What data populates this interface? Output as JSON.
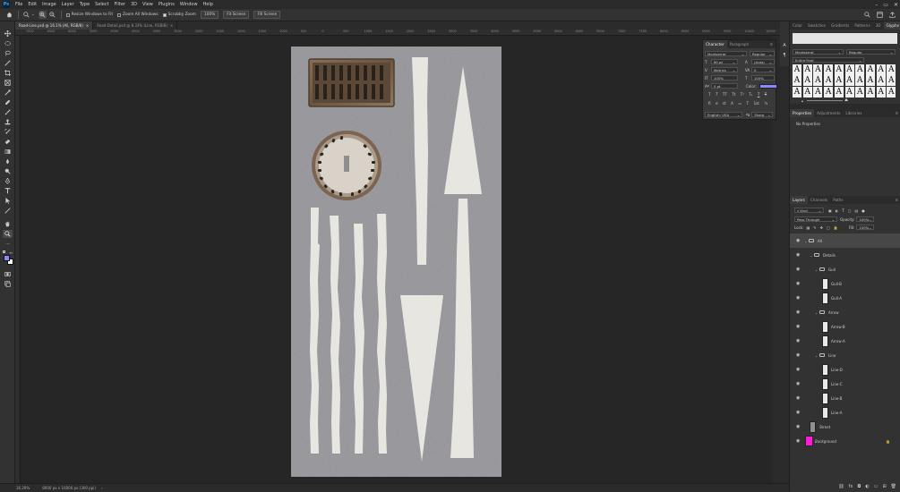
{
  "app": {
    "logo": "Ps"
  },
  "menu": [
    "File",
    "Edit",
    "Image",
    "Layer",
    "Type",
    "Select",
    "Filter",
    "3D",
    "View",
    "Plugins",
    "Window",
    "Help"
  ],
  "options": {
    "resize_windows": "Resize Windows to Fit",
    "zoom_all": "Zoom All Windows",
    "scrubby_zoom": "Scrubby Zoom",
    "zoom_value": "100%",
    "fit_screen": "Fit Screen",
    "fill_screen": "Fill Screen"
  },
  "tabs": [
    {
      "label": "Road-Line.psd @ 16.1% (All, RGB/8)",
      "active": true
    },
    {
      "label": "Road-Detail.psd @ 8.33% (Line, RGB/8)",
      "active": false
    }
  ],
  "ruler_numbers": [
    "7000",
    "6500",
    "6000",
    "5500",
    "5000",
    "4500",
    "4000",
    "3500",
    "3000",
    "2500",
    "2000",
    "1500",
    "1000",
    "500",
    "0",
    "500",
    "1000",
    "1500",
    "2000",
    "2500",
    "3000",
    "3500",
    "4000",
    "4500",
    "5000",
    "5500",
    "6000",
    "6500",
    "7000",
    "7500",
    "8000",
    "8500",
    "9000",
    "9500",
    "10000",
    "10500"
  ],
  "status": {
    "zoom": "16.29%",
    "doc": "8000 px x 16000 px (300 ppi)"
  },
  "character_panel": {
    "tabs": [
      "Character",
      "Paragraph"
    ],
    "font_family": "Montserrat",
    "font_style": "Regular",
    "size": "60 pt",
    "leading": "(Auto)",
    "kerning": "Metrics",
    "tracking": "0",
    "vscale": "100%",
    "hscale": "100%",
    "baseline": "0 pt",
    "color_label": "Color:",
    "color": "#8a8aff",
    "language": "English: USA",
    "antialias": "Sharp"
  },
  "glyphs_panel": {
    "tabs": [
      "Color",
      "Swatches",
      "Gradients",
      "Patterns",
      "3D",
      "Glyphs"
    ],
    "font": "Montserrat",
    "style": "Regular",
    "subset": "Entire Font",
    "glyph": "A"
  },
  "properties_panel": {
    "tabs": [
      "Properties",
      "Adjustments",
      "Libraries"
    ],
    "text": "No Properties"
  },
  "layers_panel": {
    "tabs": [
      "Layers",
      "Channels",
      "Paths"
    ],
    "filter": "Kind",
    "blend": "Pass Through",
    "opacity_label": "Opacity:",
    "opacity": "100%",
    "lock_label": "Lock:",
    "fill_label": "Fill:",
    "fill": "100%",
    "layers": [
      {
        "name": "All",
        "type": "group",
        "indent": 0,
        "selected": true
      },
      {
        "name": "Details",
        "type": "group",
        "indent": 1
      },
      {
        "name": "Gull",
        "type": "group",
        "indent": 2
      },
      {
        "name": "Gull-B",
        "type": "layer",
        "indent": 3
      },
      {
        "name": "Gull-A",
        "type": "layer",
        "indent": 3
      },
      {
        "name": "Arrow",
        "type": "group",
        "indent": 2
      },
      {
        "name": "Arrow-B",
        "type": "layer",
        "indent": 3
      },
      {
        "name": "Arrow-A",
        "type": "layer",
        "indent": 3
      },
      {
        "name": "Line",
        "type": "group",
        "indent": 2
      },
      {
        "name": "Line-D",
        "type": "layer",
        "indent": 3
      },
      {
        "name": "Line-C",
        "type": "layer",
        "indent": 3
      },
      {
        "name": "Line-B",
        "type": "layer",
        "indent": 3
      },
      {
        "name": "Line-A",
        "type": "layer",
        "indent": 3
      },
      {
        "name": "Street",
        "type": "street",
        "indent": 1
      },
      {
        "name": "Background",
        "type": "background",
        "indent": 1,
        "color": "#ff1ad9"
      }
    ]
  },
  "colors": {
    "foreground": "#8a8aff",
    "background": "#ffffff",
    "accent": "#1473e6"
  }
}
